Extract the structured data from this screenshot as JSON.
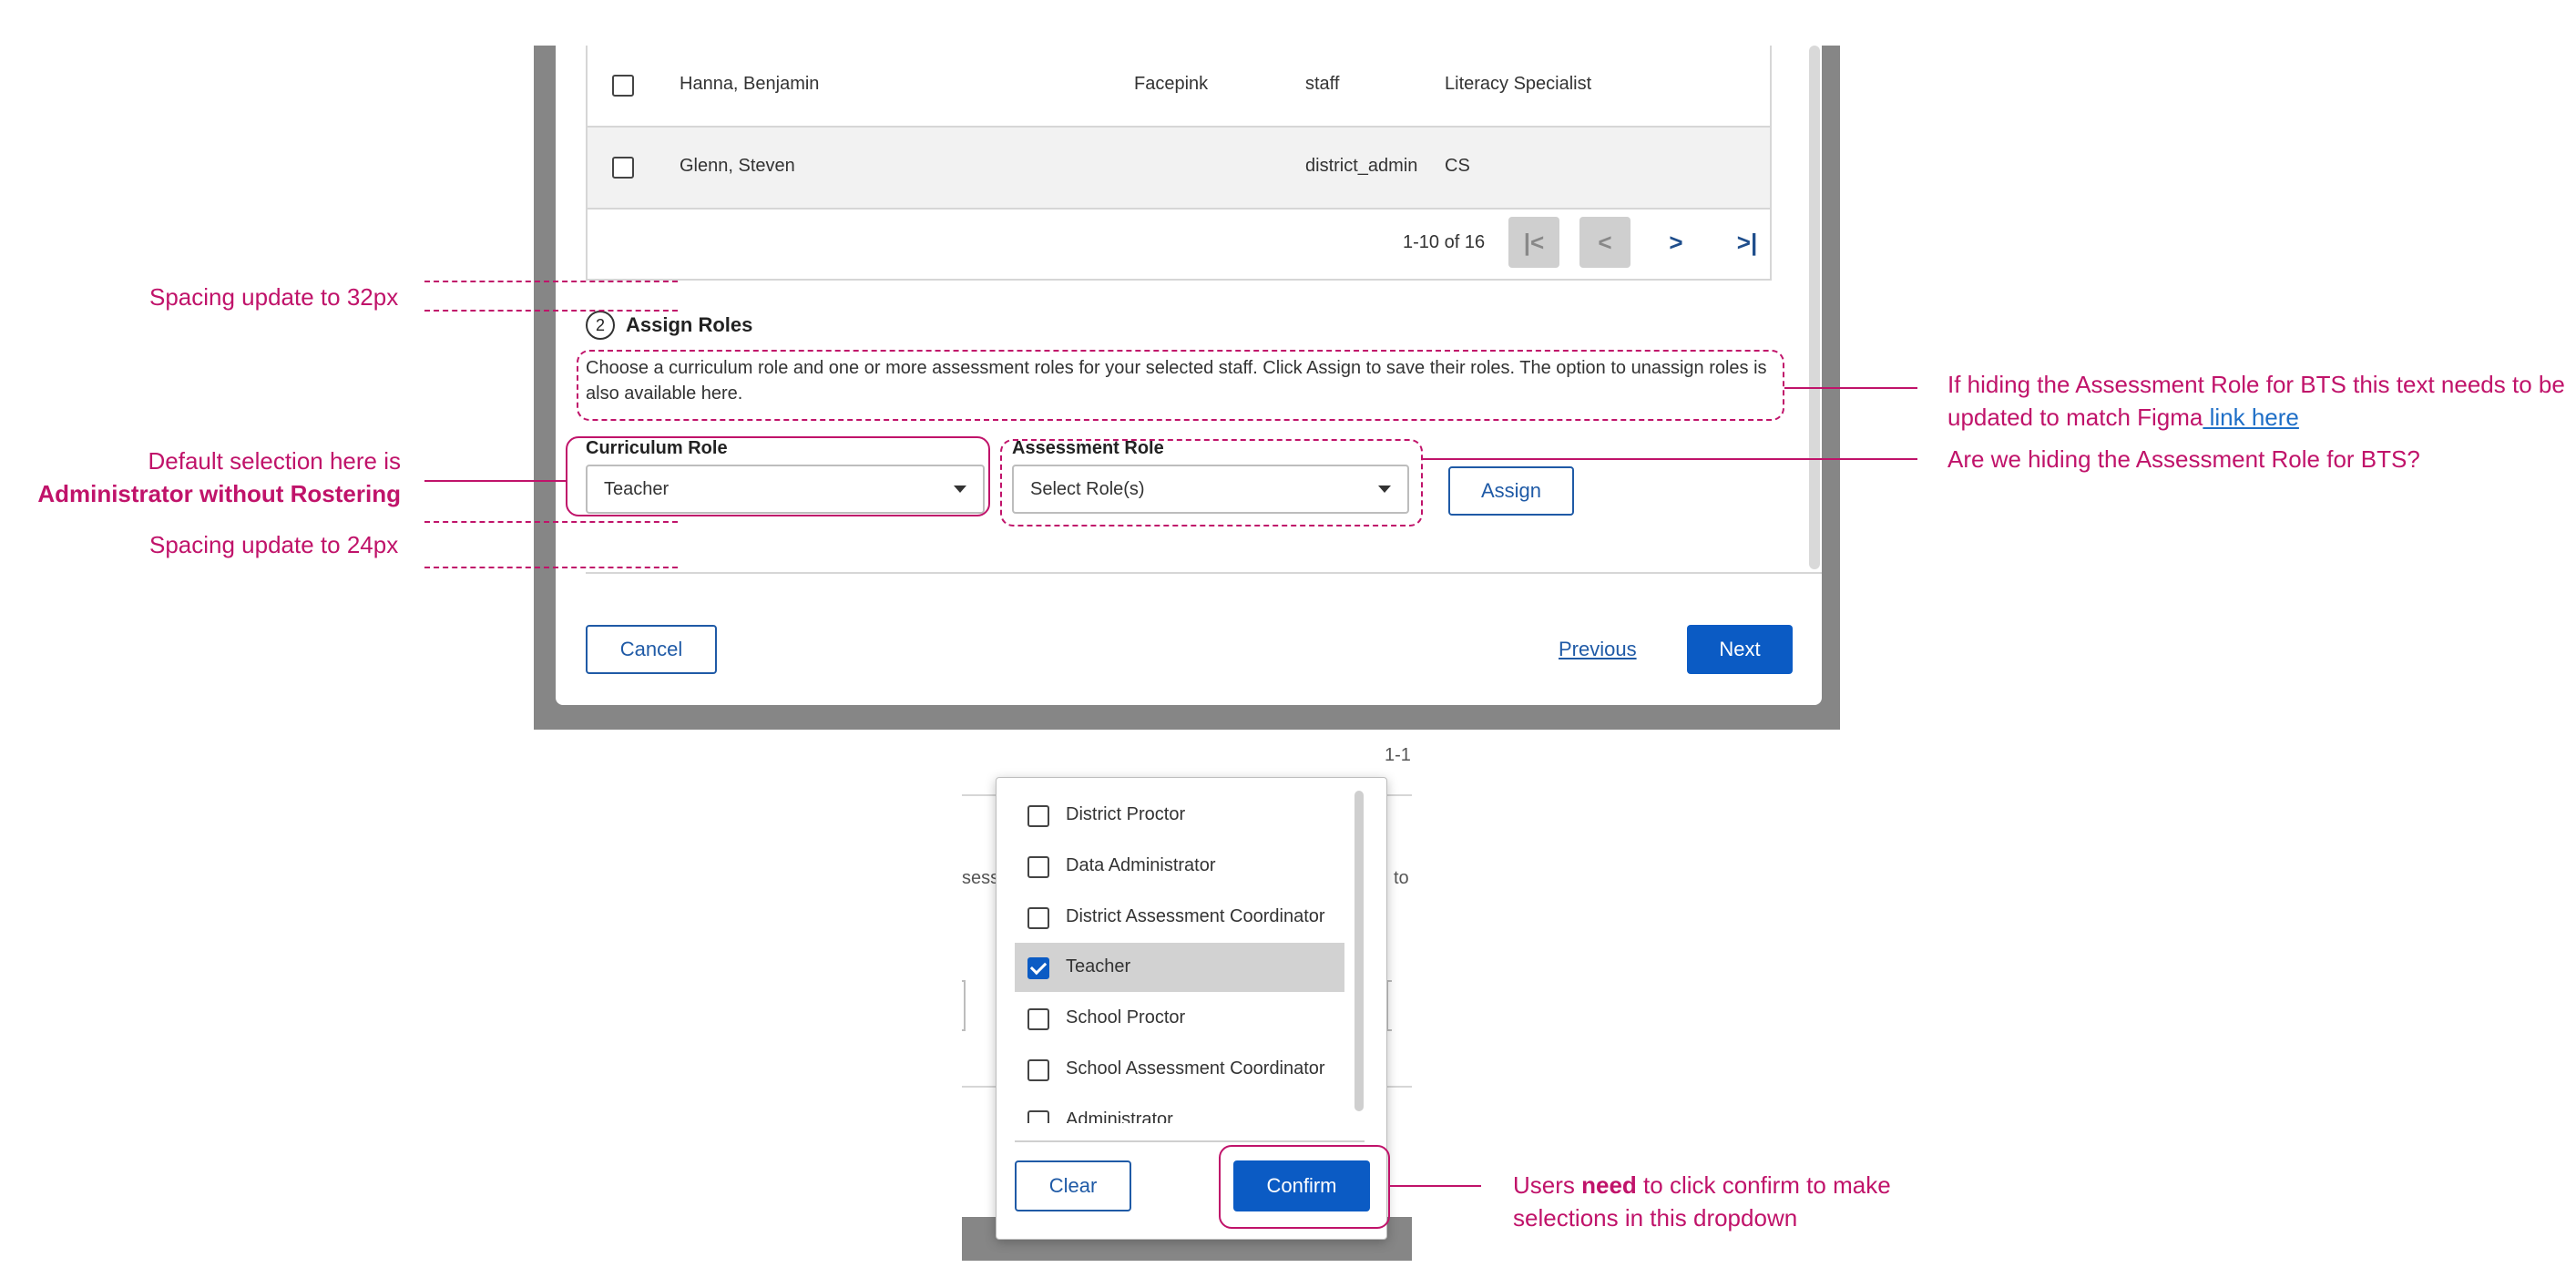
{
  "modal": {
    "table": {
      "rows": [
        {
          "name": "Hanna, Benjamin",
          "school": "Facepink",
          "role": "staff",
          "title": "Literacy Specialist"
        },
        {
          "name": "Glenn, Steven",
          "school": "",
          "role": "district_admin",
          "title": "CS"
        }
      ],
      "pagination": {
        "range": "1-10 of 16",
        "first": "|<",
        "prev": "<",
        "next": ">",
        "last": ">|"
      }
    },
    "assign": {
      "step_number": "2",
      "step_title": "Assign Roles",
      "description": "Choose a curriculum role and one or more assessment roles for your selected staff. Click Assign to save their roles. The option to unassign roles is also available here.",
      "curriculum_label": "Curriculum Role",
      "curriculum_value": "Teacher",
      "assessment_label": "Assessment Role",
      "assessment_value": "Select Role(s)",
      "assign_button": "Assign"
    },
    "footer": {
      "cancel": "Cancel",
      "previous": "Previous",
      "next": "Next"
    }
  },
  "dropdown": {
    "background_fragments": {
      "range": "1-1",
      "left_text": "sess",
      "right_text": "to"
    },
    "options": [
      {
        "label": "District Proctor",
        "checked": false
      },
      {
        "label": "Data Administrator",
        "checked": false
      },
      {
        "label": "District Assessment Coordinator",
        "checked": false
      },
      {
        "label": "Teacher",
        "checked": true
      },
      {
        "label": "School Proctor",
        "checked": false
      },
      {
        "label": "School Assessment Coordinator",
        "checked": false
      },
      {
        "label": "Administrator",
        "checked": false
      }
    ],
    "clear": "Clear",
    "confirm": "Confirm"
  },
  "annotations": {
    "spacing_32": "Spacing update to 32px",
    "default_selection_line1": "Default selection here is",
    "default_selection_line2": "Administrator without Rostering",
    "spacing_24": "Spacing update to 24px",
    "bts_text_line1": "If hiding the Assessment Role for BTS this text needs to be",
    "bts_text_line2": "updated to match Figma",
    "bts_link": " link here",
    "hiding_question": "Are we hiding the Assessment Role for BTS?",
    "confirm_note_pre": "Users ",
    "confirm_note_bold": "need",
    "confirm_note_post": " to click confirm to make",
    "confirm_note_line2": "selections in this dropdown"
  },
  "colors": {
    "annotation": "#c0136a",
    "primary": "#0b5bc4",
    "link": "#1f6fc7"
  }
}
